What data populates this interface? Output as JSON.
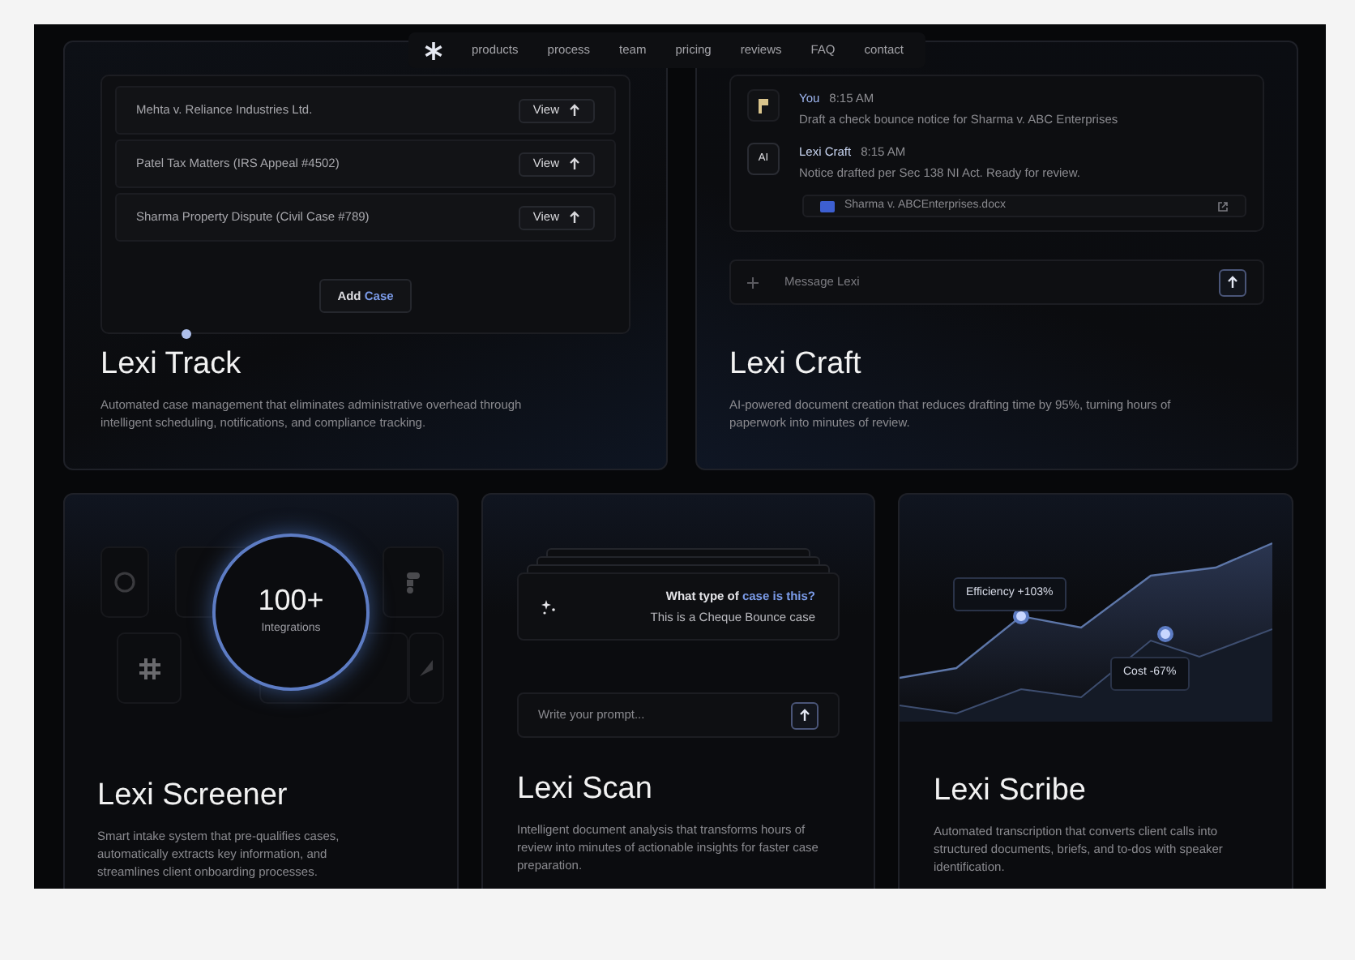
{
  "nav": {
    "items": [
      {
        "label": "products"
      },
      {
        "label": "process"
      },
      {
        "label": "team"
      },
      {
        "label": "pricing"
      },
      {
        "label": "reviews"
      },
      {
        "label": "FAQ"
      },
      {
        "label": "contact"
      }
    ]
  },
  "track": {
    "cases": [
      {
        "name": "Mehta v. Reliance Industries Ltd.",
        "action": "View"
      },
      {
        "name": "Patel Tax Matters (IRS Appeal #4502)",
        "action": "View"
      },
      {
        "name": "Sharma Property Dispute (Civil Case #789)",
        "action": "View"
      }
    ],
    "add_button": [
      {
        "text": "Add",
        "highlight": false
      },
      {
        "text": " Case",
        "highlight": true
      }
    ],
    "title": "Lexi Track",
    "description": "Automated case management that eliminates administrative overhead through intelligent scheduling, notifications, and compliance tracking."
  },
  "craft": {
    "messages": [
      {
        "kind": "user",
        "sender": "You",
        "time": "8:15 AM",
        "text": "Draft a check bounce notice for Sharma v. ABC Enterprises"
      },
      {
        "kind": "ai",
        "avatar": "AI",
        "sender": "Lexi Craft",
        "time": "8:15 AM",
        "text": "Notice drafted per Sec 138 NI Act. Ready for review."
      }
    ],
    "attachment": "Sharma v. ABCEnterprises.docx",
    "composer_placeholder": "Message Lexi",
    "title": "Lexi Craft",
    "description": "AI-powered document creation that reduces drafting time by 95%, turning hours of paperwork into minutes of review."
  },
  "screener": {
    "count": "100+",
    "count_label": "Integrations",
    "title": "Lexi Screener",
    "description": "Smart intake system that pre-qualifies cases, automatically extracts key information, and streamlines client onboarding processes."
  },
  "scan": {
    "question": [
      {
        "text": "What type of ",
        "highlight": false
      },
      {
        "text": "case is this?",
        "highlight": true
      }
    ],
    "answer": "This is a Cheque Bounce case",
    "prompt_placeholder": "Write your prompt...",
    "title": "Lexi Scan",
    "description": "Intelligent document analysis that transforms hours of review into minutes of actionable insights for faster case preparation."
  },
  "scribe": {
    "efficiency": "Efficiency +103%",
    "cost": "Cost -67%",
    "title": "Lexi Scribe",
    "description": "Automated transcription that converts client calls into structured documents, briefs, and to-dos with speaker identification."
  }
}
